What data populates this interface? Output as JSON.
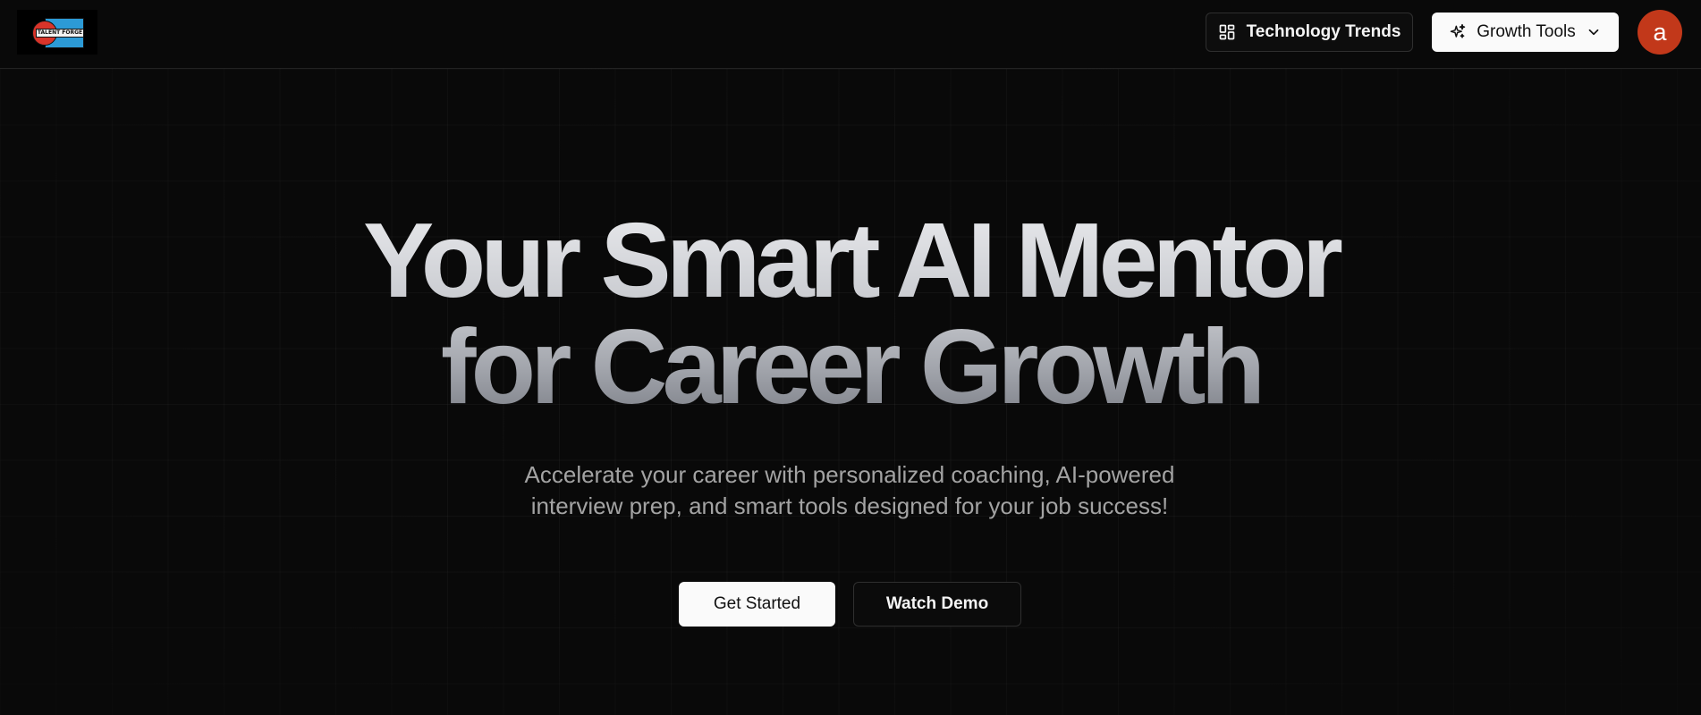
{
  "header": {
    "logo_text": "TALENT FORGE",
    "tech_trends_label": "Technology Trends",
    "growth_tools_label": "Growth Tools",
    "avatar_initial": "a"
  },
  "hero": {
    "headline_line1": "Your Smart AI Mentor",
    "headline_line2": "for Career Growth",
    "subtext": "Accelerate your career with personalized coaching, AI-powered interview prep, and smart tools designed for your job success!",
    "get_started_label": "Get Started",
    "watch_demo_label": "Watch Demo"
  },
  "colors": {
    "background": "#090909",
    "avatar": "#c2381a",
    "primary_button": "#fafafa",
    "subtext": "#a3a3a3"
  },
  "icons": {
    "tech_trends": "dashboard-grid-icon",
    "growth_tools": "sparkles-icon",
    "dropdown": "chevron-down-icon"
  }
}
